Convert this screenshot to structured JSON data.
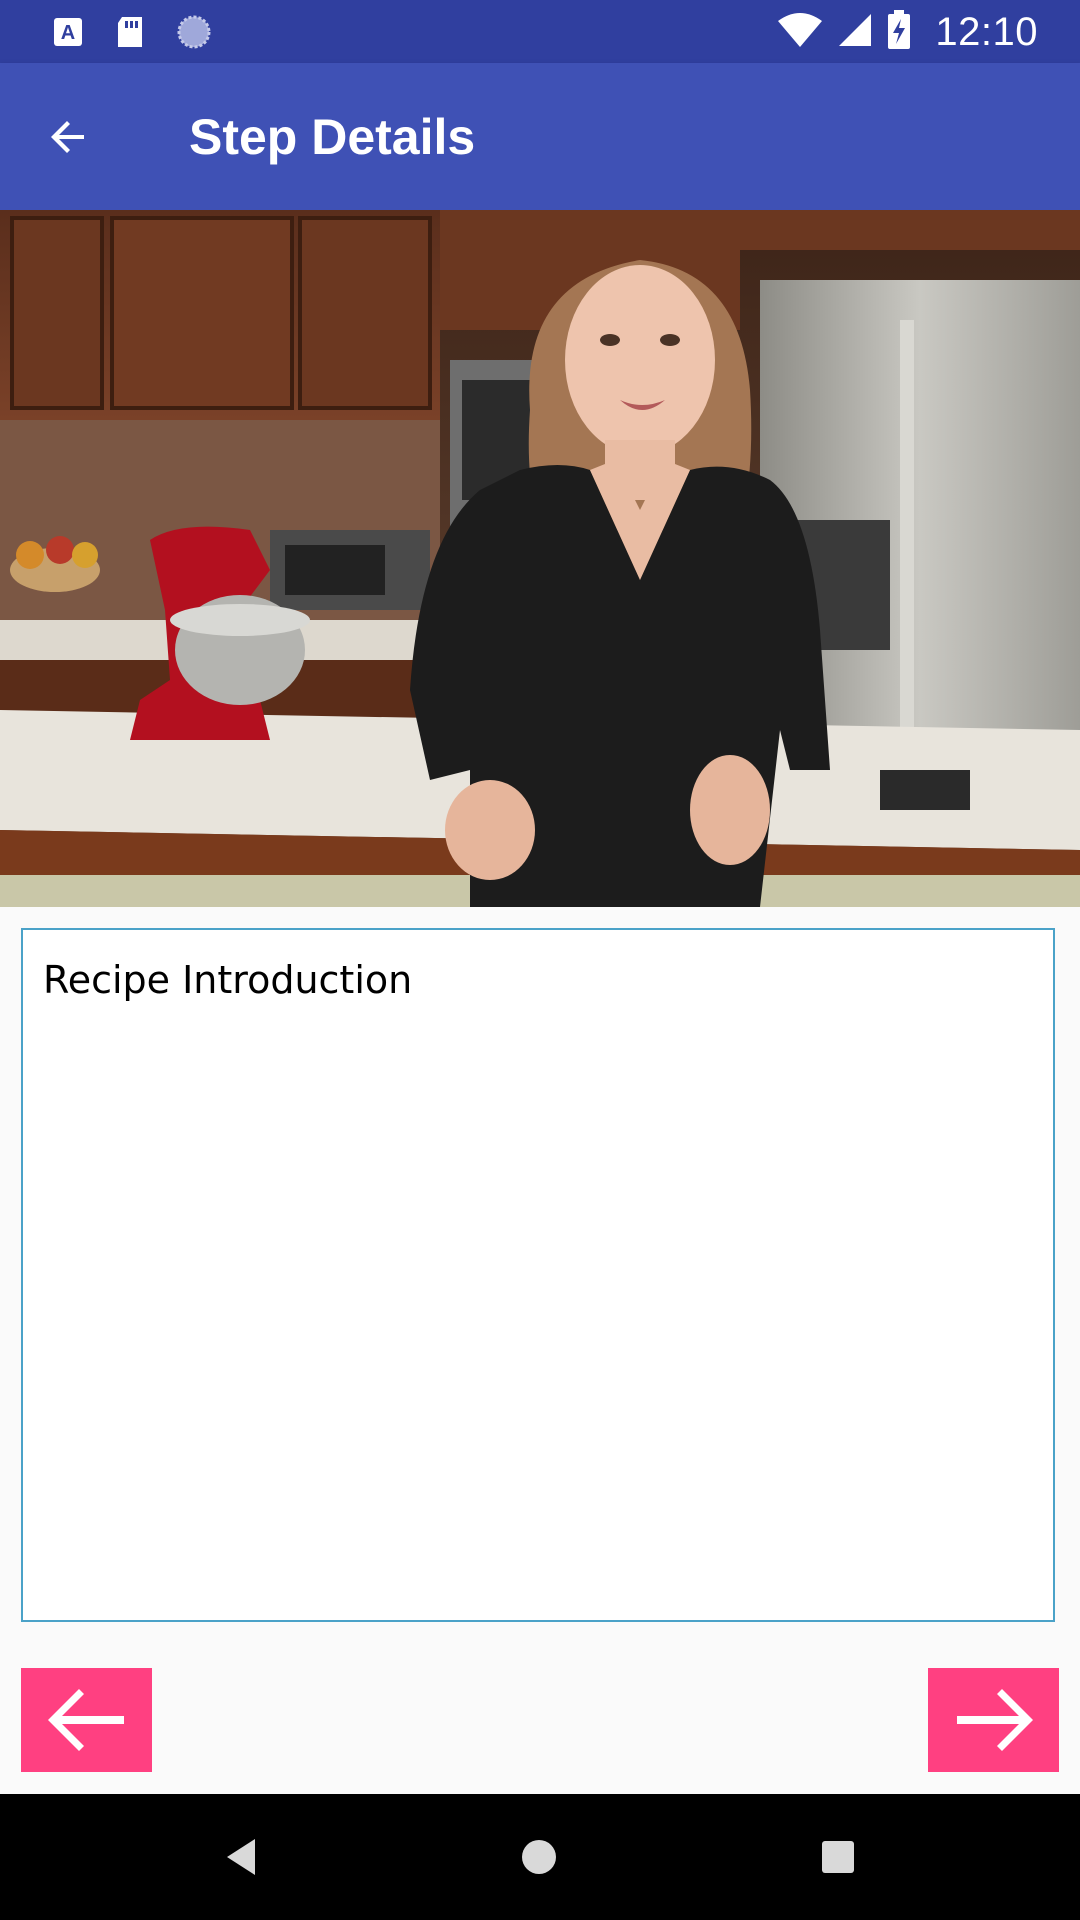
{
  "status_bar": {
    "time": "12:10",
    "left_icons": [
      "font-a-icon",
      "sd-card-icon",
      "sync-progress-icon"
    ],
    "right_icons": [
      "wifi-icon",
      "cell-signal-icon",
      "battery-charging-icon"
    ],
    "background": "#303f9f"
  },
  "app_bar": {
    "title": "Step Details",
    "back_icon": "arrow-back-icon",
    "background": "#3f51b5"
  },
  "video": {
    "content": "kitchen-presenter"
  },
  "step": {
    "description": "Recipe Introduction"
  },
  "navigation": {
    "prev_icon": "arrow-left-icon",
    "next_icon": "arrow-right-icon",
    "accent": "#ff4081"
  },
  "system_nav": {
    "buttons": [
      "back-triangle-icon",
      "home-circle-icon",
      "recents-square-icon"
    ]
  }
}
